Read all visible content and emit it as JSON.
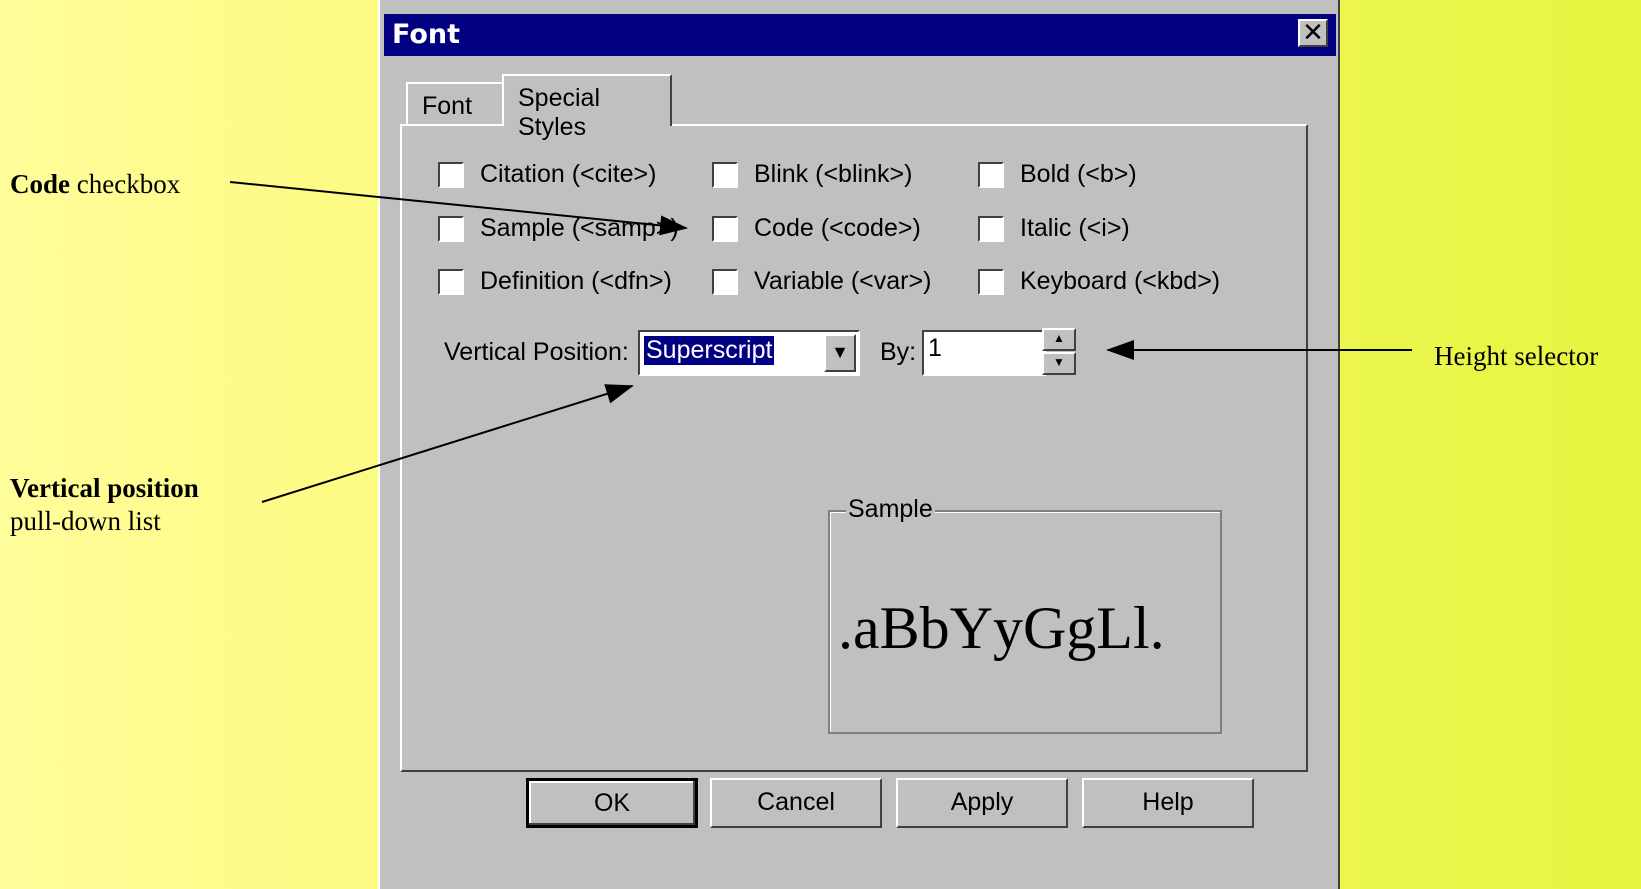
{
  "annotations": {
    "code_bold": "Code",
    "code_rest": " checkbox",
    "height": "Height selector",
    "vpos_bold": "Vertical position",
    "vpos_rest": "pull-down list"
  },
  "dialog": {
    "title": "Font",
    "close_glyph": "✕",
    "tabs": [
      "Font",
      "Special Styles"
    ],
    "checkboxes": [
      "Citation (<cite>)",
      "Blink (<blink>)",
      "Bold (<b>)",
      "Sample (<samp>)",
      "Code (<code>)",
      "Italic (<i>)",
      "Definition (<dfn>)",
      "Variable (<var>)",
      "Keyboard (<kbd>)"
    ],
    "vertical_position_label": "Vertical Position:",
    "vertical_position_value": "Superscript",
    "by_label": "By:",
    "by_value": "1",
    "sample_label": "Sample",
    "sample_text": ".aBbYyGgLl.",
    "buttons": [
      "OK",
      "Cancel",
      "Apply",
      "Help"
    ]
  }
}
